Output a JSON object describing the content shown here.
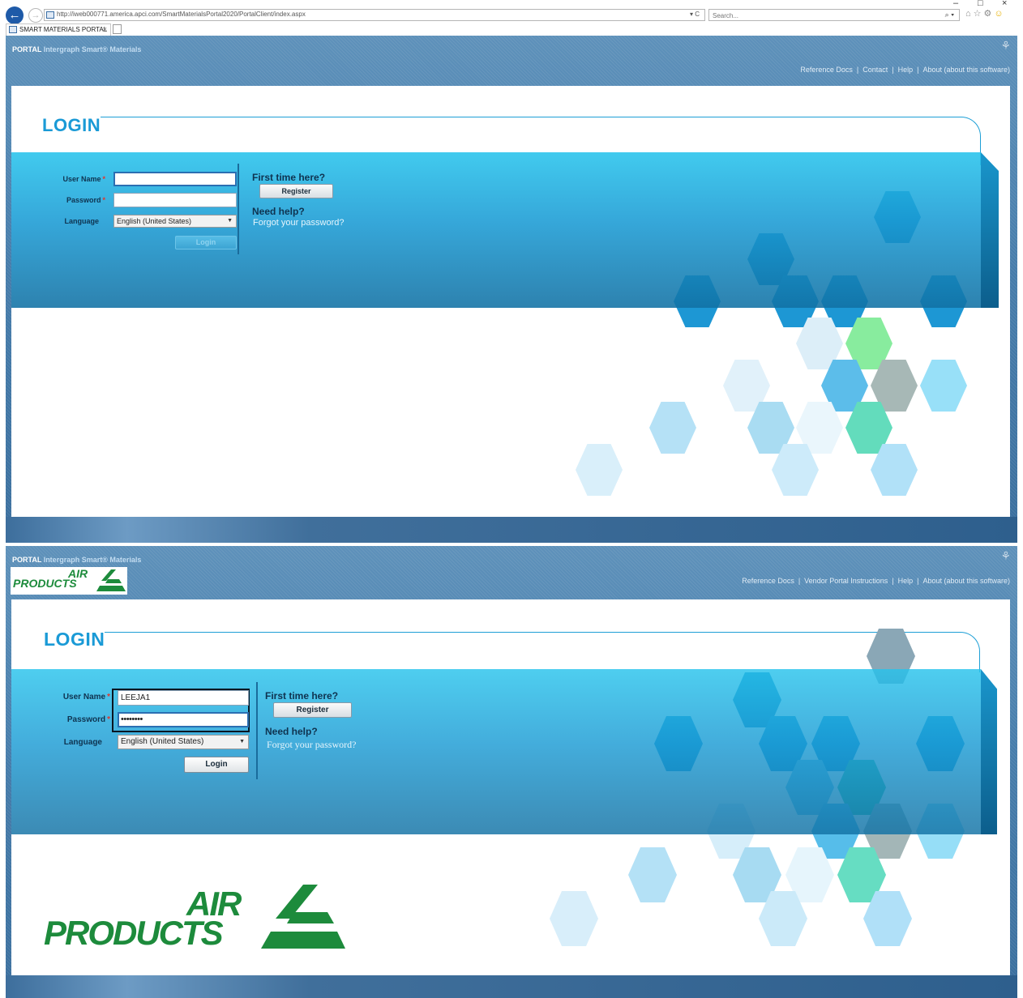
{
  "browser": {
    "url": "http://iweb000771.america.apci.com/SmartMaterialsPortal2020/PortalClient/index.aspx",
    "url_tools": "▾ C",
    "search_placeholder": "Search...",
    "tab_title": "SMART MATERIALS PORTAL",
    "tab_close": "×",
    "window_minimize": "–",
    "window_restore": "□",
    "window_close": "×",
    "icons": [
      "back-arrow-icon",
      "forward-arrow-icon",
      "search-icon",
      "home-icon",
      "favorites-star-icon",
      "settings-gear-icon",
      "smiley-feedback-icon"
    ]
  },
  "glyphs": {
    "back": "←",
    "forward": "→",
    "search": "⌕ ▾",
    "home": "⌂",
    "star": "☆",
    "gear": "⚙",
    "smiley": "☺",
    "corner": "⚘",
    "dropdown": "▼"
  },
  "screen1": {
    "portal_label": "PORTAL",
    "portal_name": "Intergraph Smart® Materials",
    "links": [
      "Reference Docs",
      "Contact",
      "Help",
      "About (about this software)"
    ],
    "heading": "LOGIN",
    "username_label": "User Name",
    "password_label": "Password",
    "language_label": "Language",
    "required_mark": "*",
    "username_value": "",
    "password_value": "",
    "language_value": "English (United States)",
    "login_button": "Login",
    "login_enabled": false,
    "first_time_heading": "First time here?",
    "register_button": "Register",
    "need_help_heading": "Need help?",
    "forgot_link": "Forgot your password?"
  },
  "screen2": {
    "portal_label": "PORTAL",
    "portal_name": "Intergraph Smart® Materials",
    "logo_small": {
      "line1": "AIR",
      "line2": "PRODUCTS"
    },
    "links": [
      "Reference Docs",
      "Vendor Portal Instructions",
      "Help",
      "About (about this software)"
    ],
    "heading": "LOGIN",
    "username_label": "User Name",
    "password_label": "Password",
    "language_label": "Language",
    "required_mark": "*",
    "username_value": "LEEJA1",
    "password_value": "••••••••",
    "language_value": "English (United States)",
    "login_button": "Login",
    "login_enabled": true,
    "first_time_heading": "First time here?",
    "register_button": "Register",
    "need_help_heading": "Need help?",
    "forgot_link": "Forgot your password?",
    "logo_large": {
      "line1": "AIR",
      "line2": "PRODUCTS"
    }
  },
  "colors": {
    "header_blue": "#477dab",
    "login_heading": "#1a9ad6",
    "band_top": "#27c3ec",
    "band_bottom": "#1171a4",
    "required": "#e3352b",
    "brand_green": "#1d8b3c"
  }
}
